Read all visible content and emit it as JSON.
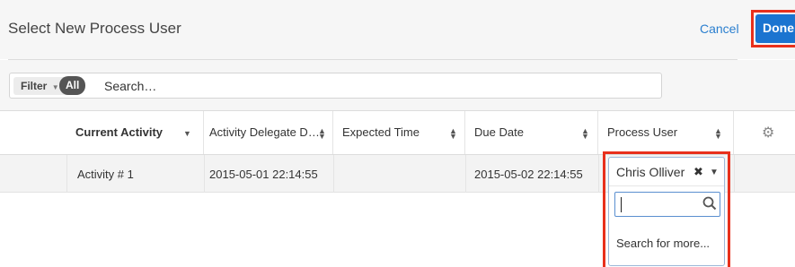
{
  "header": {
    "title": "Select New Process User",
    "cancel_label": "Cancel",
    "done_label": "Done"
  },
  "filter": {
    "filter_label": "Filter",
    "all_label": "All",
    "search_placeholder": "Search…"
  },
  "table": {
    "columns": [
      {
        "label": "Current Activity"
      },
      {
        "label": "Activity Delegate D…"
      },
      {
        "label": "Expected Time"
      },
      {
        "label": "Due Date"
      },
      {
        "label": "Process User"
      }
    ],
    "rows": [
      {
        "current_activity": "Activity # 1",
        "activity_delegate_date": "2015-05-01 22:14:55",
        "expected_time": "",
        "due_date": "2015-05-02 22:14:55"
      }
    ]
  },
  "process_user": {
    "selected": "Chris Olliver",
    "search_value": "",
    "search_more_label": "Search for more..."
  },
  "colors": {
    "accent": "#1b74d0",
    "link": "#2b7fcf",
    "highlight": "#e8301c"
  }
}
